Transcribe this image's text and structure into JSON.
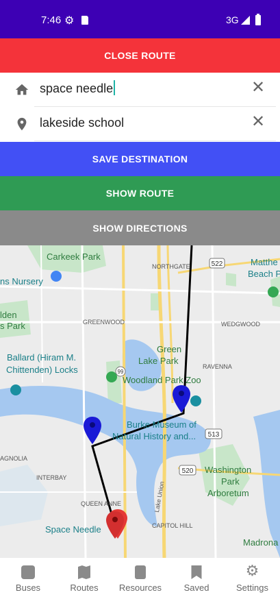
{
  "status_bar": {
    "time": "7:46",
    "network": "3G"
  },
  "buttons": {
    "close_route": "CLOSE ROUTE",
    "save_destination": "SAVE DESTINATION",
    "show_route": "SHOW ROUTE",
    "show_directions": "SHOW DIRECTIONS"
  },
  "origin": {
    "value": "space needle",
    "icon": "home-icon"
  },
  "destination": {
    "value": "lakeside school",
    "icon": "location-pin-icon"
  },
  "map": {
    "labels": {
      "carkeek_park": "Carkeek Park",
      "northgate": "NORTHGATE",
      "matthews": "Matthe",
      "beach": "Beach P",
      "nursery": "ns Nursery",
      "golden": "lden",
      "park": "s Park",
      "greenwood": "GREENWOOD",
      "wedgwood": "WEDGWOOD",
      "green_lake_park_1": "Green",
      "green_lake_park_2": "Lake Park",
      "ravenna": "RAVENNA",
      "ballard_1": "Ballard (Hiram M.",
      "ballard_2": "Chittenden) Locks",
      "woodland_park_zoo": "Woodland Park Zoo",
      "burke_1": "Burke Museum of",
      "burke_2": "Natural History and...",
      "magnolia": "AGNOLIA",
      "interbay": "INTERBAY",
      "washington_1": "Washington",
      "washington_2": "Park",
      "washington_3": "Arboretum",
      "queen_anne": "QUEEN ANNE",
      "lake_union": "Lake Union",
      "space_needle": "Space Needle",
      "capitol_hill": "CAPITOL HILL",
      "madrona": "Madrona Par",
      "hwy_522": "522",
      "hwy_99": "99",
      "hwy_513": "513",
      "hwy_520": "520"
    }
  },
  "nav": {
    "buses": "Buses",
    "routes": "Routes",
    "resources": "Resources",
    "saved": "Saved",
    "settings": "Settings"
  },
  "colors": {
    "status_bar": "#3d00b4",
    "close_route": "#f4333a",
    "save_destination": "#4250f5",
    "show_route": "#2f9b54",
    "show_directions": "#8a8a8a",
    "marker_blue": "#1a1ad6",
    "marker_red": "#e53935"
  }
}
